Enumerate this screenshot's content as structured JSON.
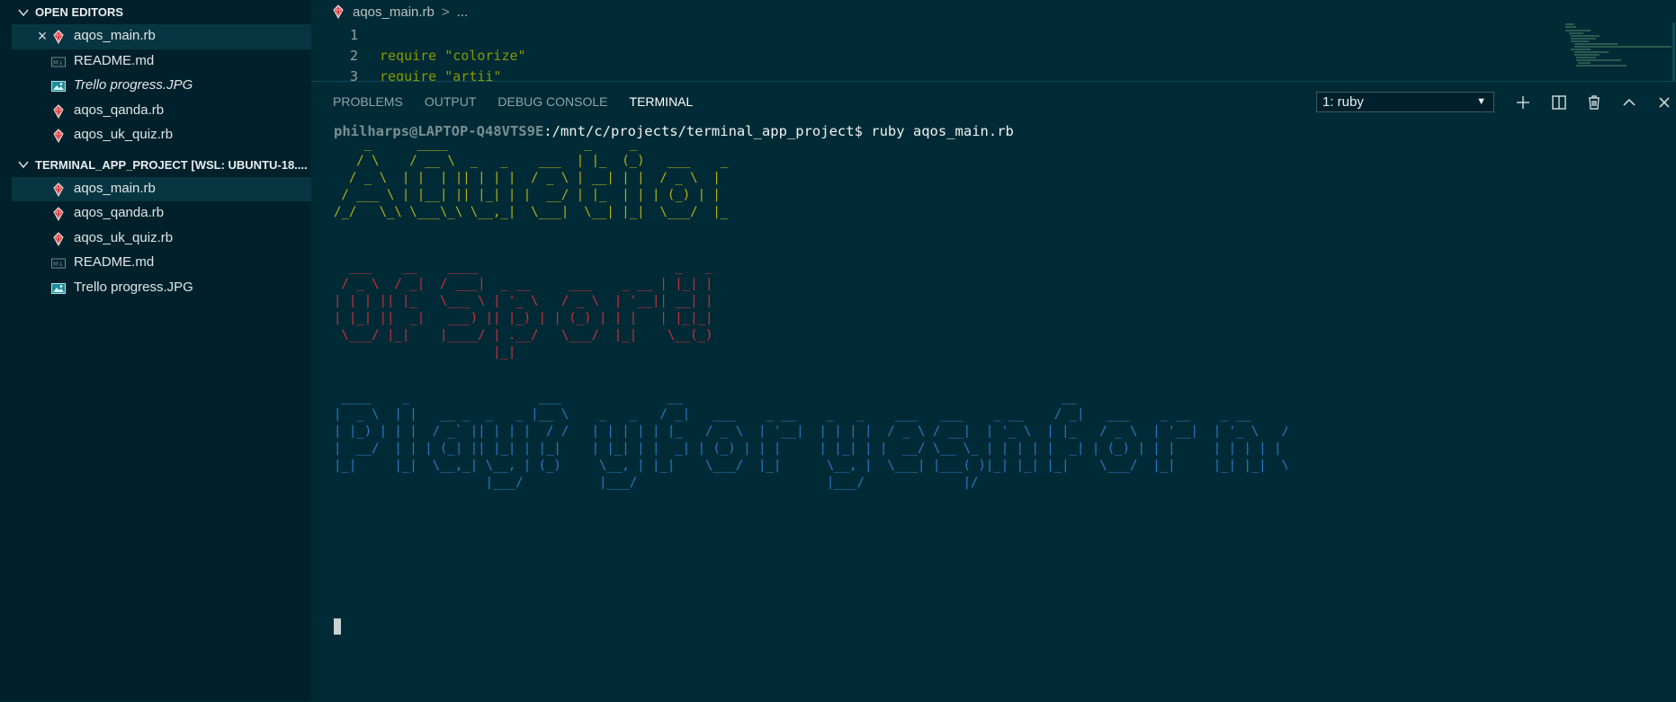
{
  "explorer": {
    "open_editors": {
      "title": "OPEN EDITORS",
      "items": [
        {
          "name": "aqos_main.rb",
          "type": "ruby"
        },
        {
          "name": "README.md",
          "type": "markdown"
        },
        {
          "name": "Trello progress.JPG",
          "type": "image"
        },
        {
          "name": "aqos_qanda.rb",
          "type": "ruby"
        },
        {
          "name": "aqos_uk_quiz.rb",
          "type": "ruby"
        }
      ]
    },
    "project": {
      "title": "TERMINAL_APP_PROJECT [WSL: UBUNTU-18....",
      "items": [
        {
          "name": "aqos_main.rb",
          "type": "ruby"
        },
        {
          "name": "aqos_qanda.rb",
          "type": "ruby"
        },
        {
          "name": "aqos_uk_quiz.rb",
          "type": "ruby"
        },
        {
          "name": "README.md",
          "type": "markdown"
        },
        {
          "name": "Trello progress.JPG",
          "type": "image"
        }
      ]
    }
  },
  "editor": {
    "breadcrumb": {
      "file": "aqos_main.rb",
      "sep": ">",
      "more": "..."
    },
    "lines": [
      {
        "num": "1",
        "text": ""
      },
      {
        "num": "2",
        "text": "require \"colorize\""
      },
      {
        "num": "3",
        "text": "require \"artii\""
      }
    ]
  },
  "panel": {
    "tabs": [
      "PROBLEMS",
      "OUTPUT",
      "DEBUG CONSOLE",
      "TERMINAL"
    ],
    "active_tab": "TERMINAL",
    "terminal_select": "1: ruby",
    "tools": [
      "plus-icon",
      "split-icon",
      "trash-icon",
      "chevron-up-icon",
      "close-icon"
    ]
  },
  "terminal": {
    "prompt_user": "philharps@LAPTOP-Q48VTS9E",
    "prompt_path": ":/mnt/c/projects/terminal_app_project$ ruby aqos_main.rb",
    "banners": [
      {
        "color": "#b5b017",
        "lines": [
          "    _      ____                  _     _               ",
          "   / \\    / __ \\  _   _    ___  | |_  (_)   ___    _ __  ",
          "  / _ \\  | |  | || | | |  / _ \\ | __| | |  / _ \\  | '_ \\ ",
          " / ___ \\ | |__| || |_| | |  __/ | |_  | | | (_) | | | | |",
          "/_/   \\_\\ \\___\\_\\ \\__,_|  \\___|  \\__| |_|  \\___/  |_| |_|"
        ]
      },
      {
        "color": "#c8303a",
        "lines": [
          "  ___    __    ____                          _   _ ",
          " / _ \\  / _|  / ___|  _ __     ___    _ __ | |_| |",
          "| | | || |_   \\___ \\ | '_ \\   / _ \\  | '__|| __| |",
          "| |_| ||  _|   ___) || |_) | | (_) | | |   | |_|_|",
          " \\___/ |_|    |____/ | .__/   \\___/  |_|    \\__(_)",
          "                     |_|                          "
        ]
      },
      {
        "color": "#2a78c8",
        "lines": [
          " ____    _                 ___              __                                                  __                                  _ ",
          "|  _ \\  | |   __ _  _   _ |__ \\    _   _   / _|   ___    _ __    _   _    ___   ___    _ __    / _|   ___    _ __    _ __     ___  | |",
          "| |_) | | |  / _` || | | |  / /   | | | | | |_   / _ \\  | '__|  | | | |  / _ \\ / __|  | '_ \\  | |_   / _ \\  | '__|  | '_ \\   / _ \\ | |",
          "|  __/  | | | (_| || |_| | |_|    | |_| | |  _| | (_) | | |     | |_| | |  __/ \\__ \\_ | | | | |  _| | (_) | | |     | | | | | (_) ||_|",
          "|_|     |_|  \\__,_| \\__, | (_)     \\__, | |_|    \\___/  |_|      \\__, |  \\___| |___( )|_| |_| |_|    \\___/  |_|     |_| |_|  \\___/ (_)",
          "                    |___/          |___/                         |___/             |/                                                     "
        ]
      }
    ]
  }
}
